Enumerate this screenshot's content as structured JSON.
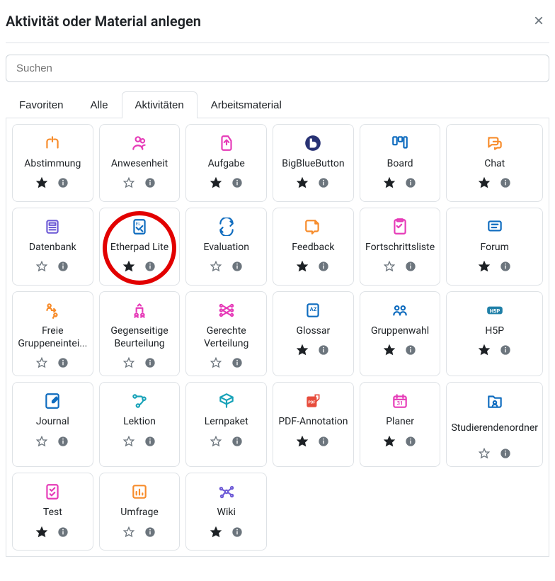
{
  "header": {
    "title": "Aktivität oder Material anlegen"
  },
  "search": {
    "placeholder": "Suchen"
  },
  "tabs": [
    {
      "id": "fav",
      "label": "Favoriten",
      "active": false
    },
    {
      "id": "all",
      "label": "Alle",
      "active": false
    },
    {
      "id": "act",
      "label": "Aktivitäten",
      "active": true
    },
    {
      "id": "mat",
      "label": "Arbeitsmaterial",
      "active": false
    }
  ],
  "items": [
    {
      "id": "abstimmung",
      "label": "Abstimmung",
      "starred": true,
      "icon": "choice",
      "color": "#f78c2b"
    },
    {
      "id": "anwesenheit",
      "label": "Anwesenheit",
      "starred": false,
      "icon": "attendance",
      "color": "#e63bb8"
    },
    {
      "id": "aufgabe",
      "label": "Aufgabe",
      "starred": true,
      "icon": "assign",
      "color": "#e63bb8"
    },
    {
      "id": "bbb",
      "label": "BigBlueButton",
      "starred": true,
      "icon": "bbb",
      "color": "#283274"
    },
    {
      "id": "board",
      "label": "Board",
      "starred": true,
      "icon": "board",
      "color": "#0f6cbf"
    },
    {
      "id": "chat",
      "label": "Chat",
      "starred": true,
      "icon": "chat",
      "color": "#f78c2b"
    },
    {
      "id": "datenbank",
      "label": "Datenbank",
      "starred": false,
      "icon": "data",
      "color": "#6e5bd6"
    },
    {
      "id": "etherpad",
      "label": "Etherpad Lite",
      "starred": true,
      "icon": "etherpad",
      "color": "#0f6cbf",
      "highlight": true
    },
    {
      "id": "evaluation",
      "label": "Evaluation",
      "starred": false,
      "icon": "eval",
      "color": "#0f6cbf"
    },
    {
      "id": "feedback",
      "label": "Feedback",
      "starred": true,
      "icon": "feedback",
      "color": "#f78c2b"
    },
    {
      "id": "fortschritt",
      "label": "Fortschrittsliste",
      "starred": false,
      "icon": "checklist",
      "color": "#e63bb8"
    },
    {
      "id": "forum",
      "label": "Forum",
      "starred": true,
      "icon": "forum",
      "color": "#0f6cbf"
    },
    {
      "id": "freiegruppe",
      "label": "Freie Gruppeneintei...",
      "starred": false,
      "icon": "freegroup",
      "color": "#f78c2b",
      "multiline": true
    },
    {
      "id": "gegenseitig",
      "label": "Gegenseitige Beurteilung",
      "starred": false,
      "icon": "workshop",
      "color": "#e63bb8",
      "multiline": true
    },
    {
      "id": "gerechte",
      "label": "Gerechte Verteilung",
      "starred": false,
      "icon": "fair",
      "color": "#e63bb8",
      "multiline": true
    },
    {
      "id": "glossar",
      "label": "Glossar",
      "starred": true,
      "icon": "glossary",
      "color": "#0f6cbf"
    },
    {
      "id": "gruppenwahl",
      "label": "Gruppenwahl",
      "starred": true,
      "icon": "groupchoice",
      "color": "#0f6cbf"
    },
    {
      "id": "h5p",
      "label": "H5P",
      "starred": true,
      "icon": "h5p",
      "color": "#2080a8"
    },
    {
      "id": "journal",
      "label": "Journal",
      "starred": false,
      "icon": "journal",
      "color": "#0f6cbf"
    },
    {
      "id": "lektion",
      "label": "Lektion",
      "starred": false,
      "icon": "lesson",
      "color": "#17a2b8"
    },
    {
      "id": "lernpaket",
      "label": "Lernpaket",
      "starred": false,
      "icon": "scorm",
      "color": "#17a2b8"
    },
    {
      "id": "pdfannot",
      "label": "PDF-Annotation",
      "starred": true,
      "icon": "pdf",
      "color": "#e74c3c"
    },
    {
      "id": "planer",
      "label": "Planer",
      "starred": true,
      "icon": "scheduler",
      "color": "#e63bb8"
    },
    {
      "id": "studierenden",
      "label": "Studierendenordner",
      "starred": false,
      "icon": "studentfolder",
      "color": "#0f6cbf",
      "multiline": true
    },
    {
      "id": "test",
      "label": "Test",
      "starred": true,
      "icon": "quiz",
      "color": "#e63bb8"
    },
    {
      "id": "umfrage",
      "label": "Umfrage",
      "starred": false,
      "icon": "survey",
      "color": "#f78c2b"
    },
    {
      "id": "wiki",
      "label": "Wiki",
      "starred": true,
      "icon": "wiki",
      "color": "#6e5bd6"
    }
  ]
}
